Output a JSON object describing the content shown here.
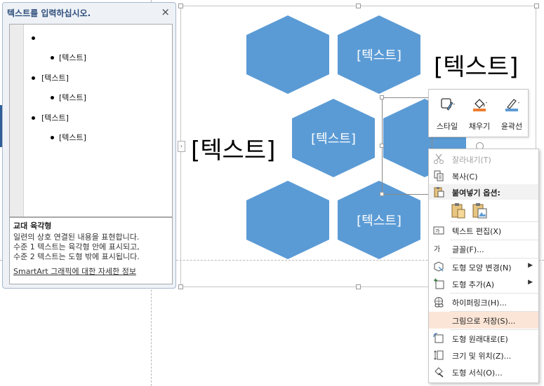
{
  "text_pane": {
    "title": "텍스트를 입력하십시오.",
    "close": "×",
    "bullets": [
      {
        "level": 1,
        "text": ""
      },
      {
        "level": 2,
        "text": "[텍스트]"
      },
      {
        "level": 1,
        "text": "[텍스트]"
      },
      {
        "level": 2,
        "text": "[텍스트]"
      },
      {
        "level": 1,
        "text": "[텍스트]"
      },
      {
        "level": 2,
        "text": "[텍스트]"
      }
    ],
    "description": {
      "title": "교대 육각형",
      "lines": [
        "일련의 상호 연결된 내용을 표현합니다.",
        "수준 1 텍스트는 육각형 안에 표시되고,",
        "수준 2 텍스트는 도형 밖에 표시됩니다."
      ],
      "link": "SmartArt 그래픽에 대한 자세한 정보"
    }
  },
  "smartart": {
    "hex_color": "#5b9bd5",
    "hex_mid_right": "[텍스트]",
    "hex_center": "[텍스트]",
    "hex_bottom_right": "[텍스트]",
    "outer_top": "[텍스트]",
    "outer_left": "[텍스트]",
    "expand_arrow": "›"
  },
  "mini_toolbar": {
    "style": "스타일",
    "fill": "채우기",
    "outline": "윤곽선",
    "fill_color": "#ed7d31",
    "outline_color": "#5b9bd5"
  },
  "context_menu": {
    "cut": "잘라내기(T)",
    "copy": "복사(C)",
    "paste_options": "붙여넣기 옵션:",
    "edit_text": "텍스트 편집(X)",
    "font": "글꼴(F)...",
    "change_shape": "도형 모양 변경(N)",
    "add_shape": "도형 추가(A)",
    "hyperlink": "하이퍼링크(H)...",
    "save_as_picture": "그림으로 저장(S)...",
    "reset_shape": "도형 원래대로(E)",
    "size_position": "크기 및 위치(Z)...",
    "format_shape": "도형 서식(O)...",
    "submenu_arrow": "▶",
    "highlight_color": "#fbe5d6"
  }
}
